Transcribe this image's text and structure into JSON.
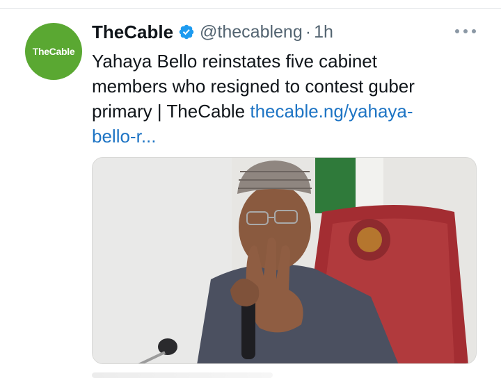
{
  "tweet": {
    "author_name": "TheCable",
    "handle": "@thecableng",
    "separator": "·",
    "time": "1h",
    "avatar_text": "TheCable",
    "text": "Yahaya Bello reinstates five cabinet members who resigned to contest guber primary | TheCable ",
    "link_text": "thecable.ng/yahaya-bello-r...",
    "media_description_icon": "photo",
    "colors": {
      "avatar_bg": "#5aa832",
      "verified_badge": "#1d9bf0",
      "link": "#1d74c4",
      "secondary_text": "#536471"
    }
  },
  "icons": {
    "verified": "verified-badge-icon",
    "more": "more-options-icon"
  }
}
